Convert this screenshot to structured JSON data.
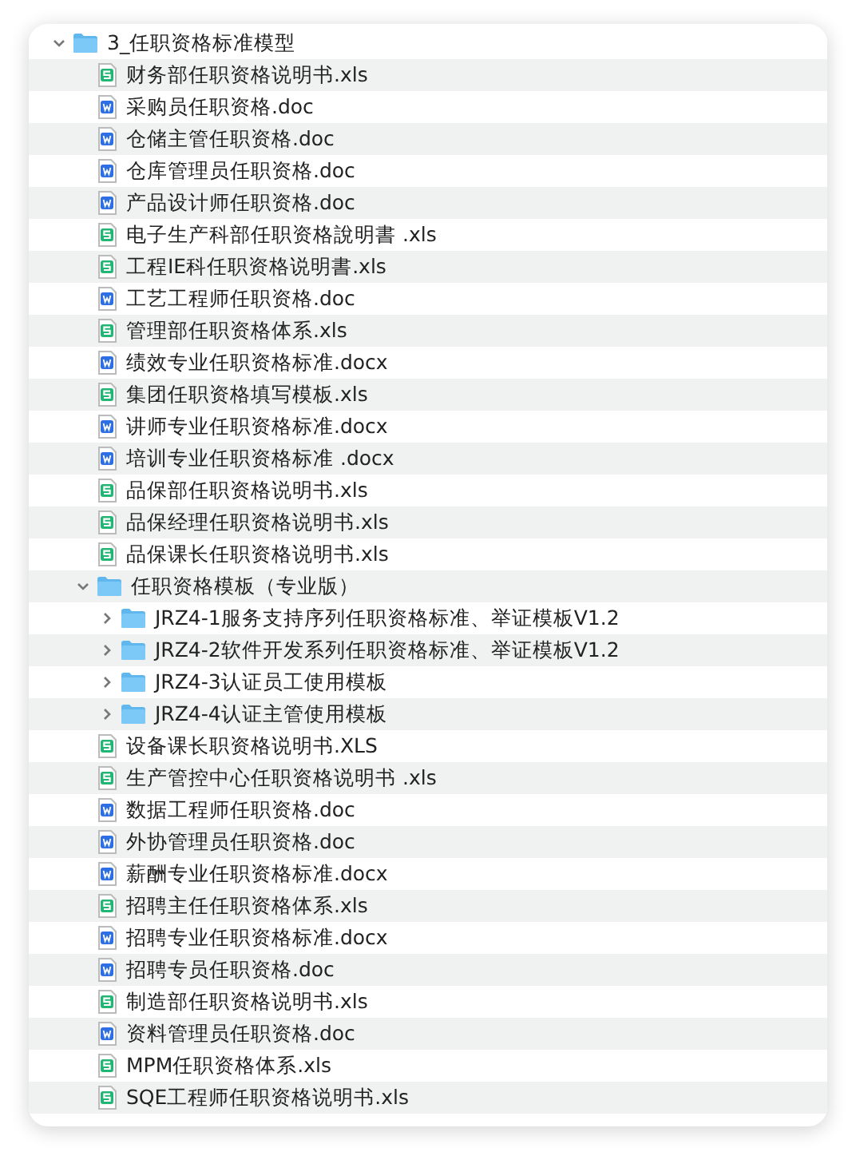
{
  "tree": [
    {
      "kind": "folder",
      "name": "3_任职资格标准模型",
      "expanded": true,
      "children": [
        {
          "kind": "sheet",
          "name": "财务部任职资格说明书.xls"
        },
        {
          "kind": "doc",
          "name": "采购员任职资格.doc"
        },
        {
          "kind": "doc",
          "name": "仓储主管任职资格.doc"
        },
        {
          "kind": "doc",
          "name": "仓库管理员任职资格.doc"
        },
        {
          "kind": "doc",
          "name": "产品设计师任职资格.doc"
        },
        {
          "kind": "sheet",
          "name": "电子生产科部任职资格說明書 .xls"
        },
        {
          "kind": "sheet",
          "name": "工程IE科任职资格说明書.xls"
        },
        {
          "kind": "doc",
          "name": "工艺工程师任职资格.doc"
        },
        {
          "kind": "sheet",
          "name": "管理部任职资格体系.xls"
        },
        {
          "kind": "doc",
          "name": "绩效专业任职资格标准.docx"
        },
        {
          "kind": "sheet",
          "name": "集团任职资格填写模板.xls"
        },
        {
          "kind": "doc",
          "name": "讲师专业任职资格标准.docx"
        },
        {
          "kind": "doc",
          "name": "培训专业任职资格标准 .docx"
        },
        {
          "kind": "sheet",
          "name": "品保部任职资格说明书.xls"
        },
        {
          "kind": "sheet",
          "name": "品保经理任职资格说明书.xls"
        },
        {
          "kind": "sheet",
          "name": "品保课长任职资格说明书.xls"
        },
        {
          "kind": "folder",
          "name": "任职资格模板（专业版）",
          "expanded": true,
          "children": [
            {
              "kind": "folder",
              "name": "JRZ4-1服务支持序列任职资格标准、举证模板V1.2",
              "expanded": false
            },
            {
              "kind": "folder",
              "name": "JRZ4-2软件开发系列任职资格标准、举证模板V1.2",
              "expanded": false
            },
            {
              "kind": "folder",
              "name": "JRZ4-3认证员工使用模板",
              "expanded": false
            },
            {
              "kind": "folder",
              "name": "JRZ4-4认证主管使用模板",
              "expanded": false
            }
          ]
        },
        {
          "kind": "sheet",
          "name": "设备课长职资格说明书.XLS"
        },
        {
          "kind": "sheet",
          "name": "生产管控中心任职资格说明书 .xls"
        },
        {
          "kind": "doc",
          "name": "数据工程师任职资格.doc"
        },
        {
          "kind": "doc",
          "name": "外协管理员任职资格.doc"
        },
        {
          "kind": "doc",
          "name": "薪酬专业任职资格标准.docx"
        },
        {
          "kind": "sheet",
          "name": "招聘主任任职资格体系.xls"
        },
        {
          "kind": "doc",
          "name": "招聘专业任职资格标准.docx"
        },
        {
          "kind": "doc",
          "name": "招聘专员任职资格.doc"
        },
        {
          "kind": "sheet",
          "name": "制造部任职资格说明书.xls"
        },
        {
          "kind": "doc",
          "name": "资料管理员任职资格.doc"
        },
        {
          "kind": "sheet",
          "name": "MPM任职资格体系.xls"
        },
        {
          "kind": "sheet",
          "name": "SQE工程师任职资格说明书.xls"
        }
      ]
    }
  ]
}
